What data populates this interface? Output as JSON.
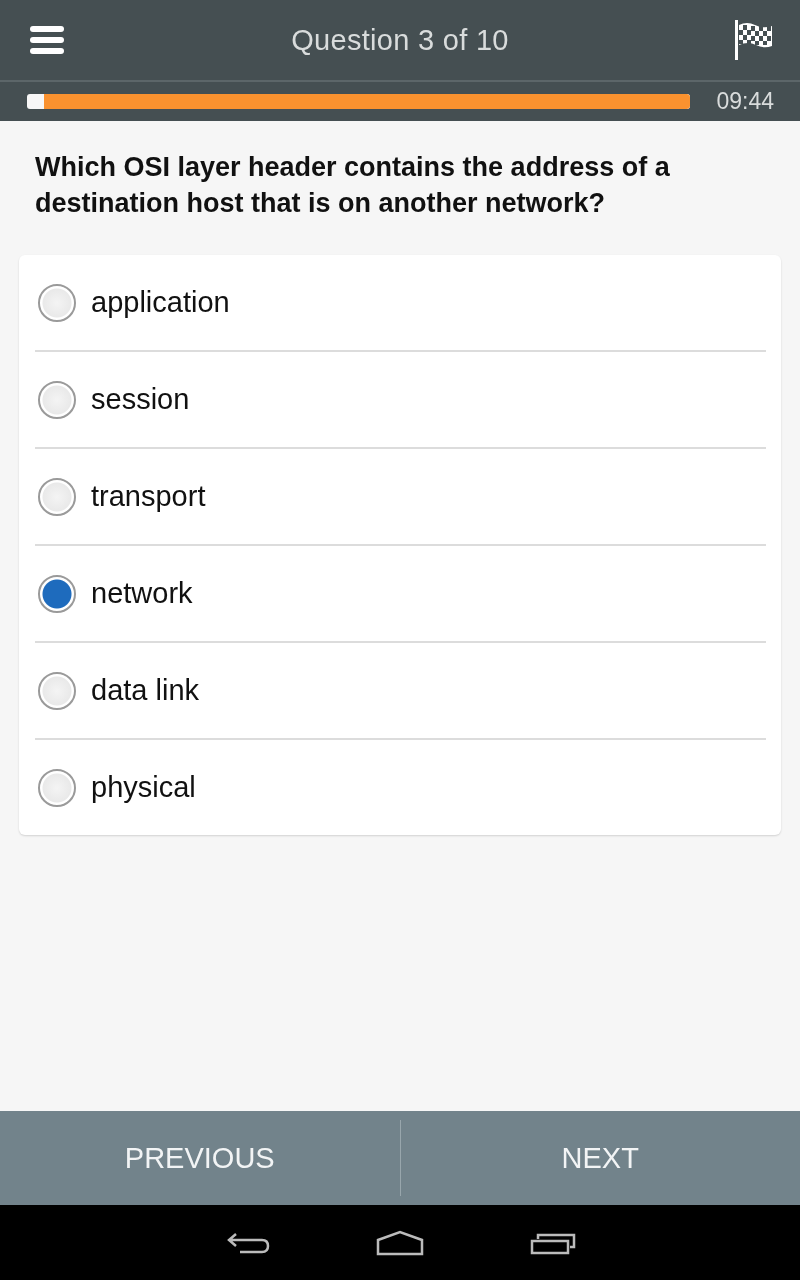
{
  "header": {
    "title": "Question 3 of 10"
  },
  "timer": {
    "level": 0.975,
    "time": "09:44"
  },
  "question": {
    "text": "Which OSI layer header contains the address of a destination host that is on another network?"
  },
  "options": [
    {
      "label": "application",
      "selected": false
    },
    {
      "label": "session",
      "selected": false
    },
    {
      "label": "transport",
      "selected": false
    },
    {
      "label": "network",
      "selected": true
    },
    {
      "label": "data link",
      "selected": false
    },
    {
      "label": "physical",
      "selected": false
    }
  ],
  "footer": {
    "buttons": [
      "PREVIOUS",
      "NEXT"
    ]
  }
}
